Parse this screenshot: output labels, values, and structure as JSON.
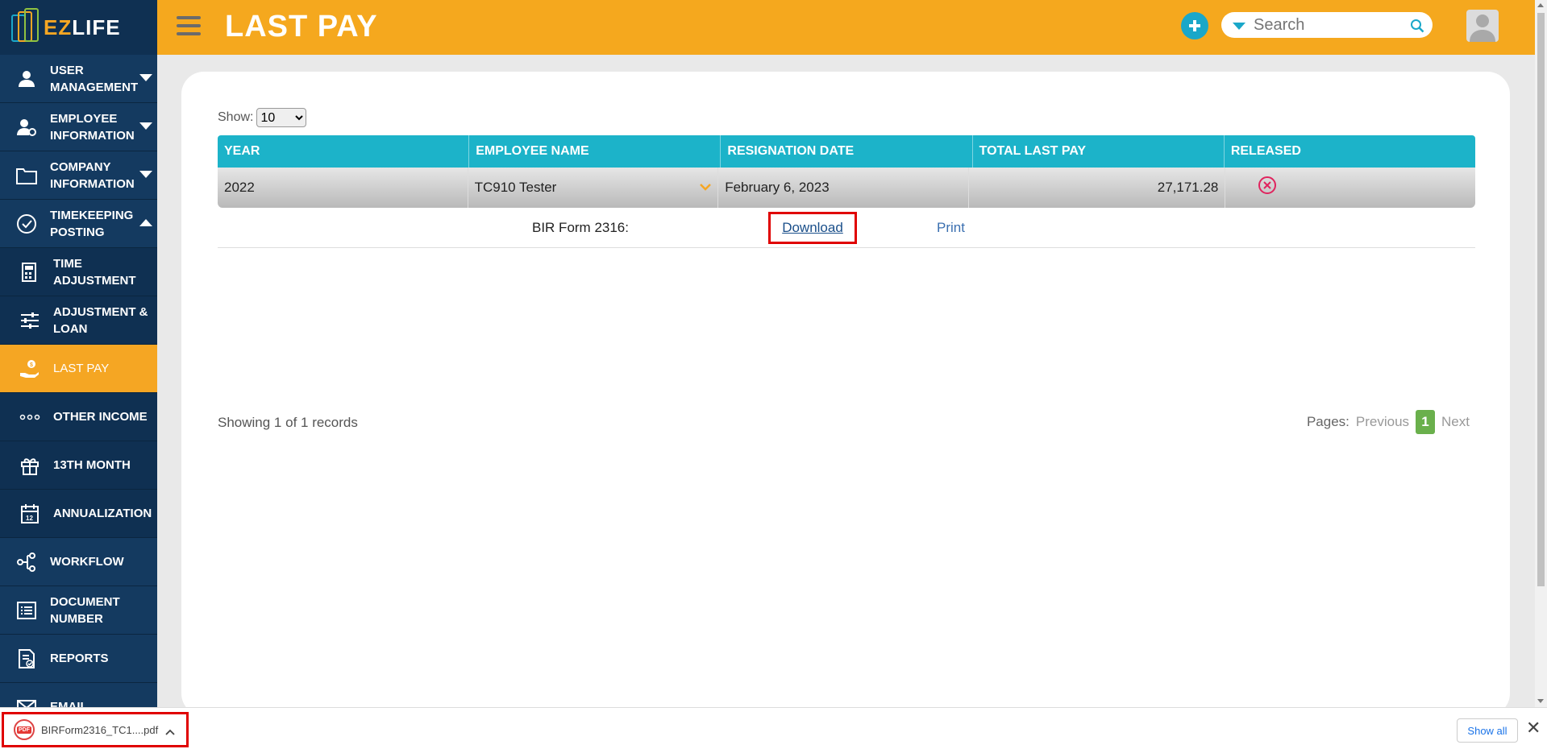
{
  "app": {
    "logo_ez": "EZ",
    "logo_life": "LIFE"
  },
  "header": {
    "title": "LAST PAY",
    "search_placeholder": "Search"
  },
  "sidebar": {
    "items": [
      {
        "label1": "USER",
        "label2": "MANAGEMENT",
        "icon": "user-icon"
      },
      {
        "label1": "EMPLOYEE",
        "label2": "INFORMATION",
        "icon": "employee-settings-icon"
      },
      {
        "label1": "COMPANY",
        "label2": "INFORMATION",
        "icon": "folder-icon"
      },
      {
        "label1": "TIMEKEEPING",
        "label2": "POSTING",
        "icon": "check-circle-icon"
      },
      {
        "label1": "TIME",
        "label2": "ADJUSTMENT",
        "icon": "calculator-icon"
      },
      {
        "label1": "ADJUSTMENT &",
        "label2": "LOAN",
        "icon": "sliders-icon"
      },
      {
        "label1": "LAST PAY",
        "icon": "hand-money-icon"
      },
      {
        "label1": "OTHER INCOME",
        "icon": "dots-icon"
      },
      {
        "label1": "13TH MONTH",
        "icon": "gift-icon"
      },
      {
        "label1": "ANNUALIZATION",
        "icon": "calendar-icon"
      },
      {
        "label1": "WORKFLOW",
        "icon": "workflow-icon"
      },
      {
        "label1": "DOCUMENT",
        "label2": "NUMBER",
        "icon": "document-list-icon"
      },
      {
        "label1": "REPORTS",
        "icon": "report-icon"
      },
      {
        "label1": "EMAIL",
        "icon": "mail-icon"
      }
    ]
  },
  "table": {
    "show_label": "Show:",
    "page_size": "10",
    "columns": [
      "YEAR",
      "EMPLOYEE NAME",
      "RESIGNATION DATE",
      "TOTAL LAST PAY",
      "RELEASED"
    ],
    "rows": [
      {
        "year": "2022",
        "employee": "TC910 Tester",
        "resignation_date": "February 6, 2023",
        "total": "27,171.28"
      }
    ],
    "detail": {
      "label": "BIR Form 2316:",
      "download": "Download",
      "print": "Print"
    },
    "records_text": "Showing 1 of 1 records",
    "pager": {
      "label": "Pages:",
      "previous": "Previous",
      "current": "1",
      "next": "Next"
    }
  },
  "download_bar": {
    "filename": "BIRForm2316_TC1....pdf",
    "file_icon_text": "PDF",
    "show_all": "Show all",
    "close": "✕"
  },
  "colors": {
    "header": "#f5a81e",
    "sidebar": "#0f3052",
    "table_head": "#1cb3c9",
    "accent": "#1aa7c9"
  }
}
